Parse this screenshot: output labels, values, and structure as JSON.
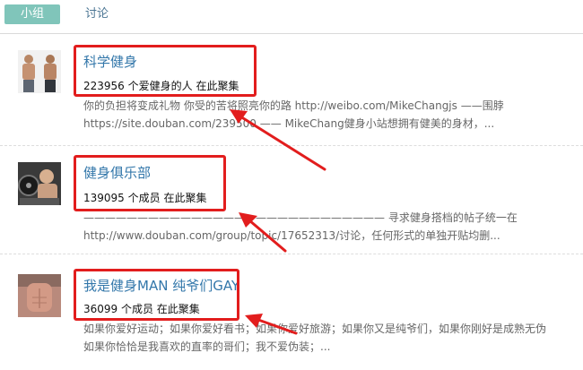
{
  "tabs": [
    {
      "label": "小组",
      "active": true
    },
    {
      "label": "讨论",
      "active": false
    }
  ],
  "groups": [
    {
      "title": "科学健身",
      "meta": "223956 个爱健身的人 在此聚集",
      "desc_line1": "你的负担将变成礼物 你受的苦将照亮你的路 http://weibo.com/MikeChangjs ——围脖",
      "desc_line2": "https://site.douban.com/239500 —— MikeChang健身小站想拥有健美的身材，..."
    },
    {
      "title": "健身俱乐部",
      "meta": "139095 个成员 在此聚集",
      "desc_line1": "———————————————————————————— 寻求健身搭档的帖子统一在",
      "desc_line2": "http://www.douban.com/group/topic/17652313/讨论，任何形式的单独开贴均删..."
    },
    {
      "title": "我是健身MAN 纯爷们GAY",
      "meta": "36099 个成员 在此聚集",
      "desc_line1": "如果你爱好运动；如果你爱好看书；如果你爱好旅游；如果你又是纯爷们，如果你刚好是成熟无伪",
      "desc_line2": "如果你恰恰是我喜欢的直率的哥们；我不爱伪装；..."
    }
  ],
  "colors": {
    "tab_active_bg": "#80c5ba",
    "link": "#3377aa",
    "annotation_red": "#e21d1d"
  }
}
